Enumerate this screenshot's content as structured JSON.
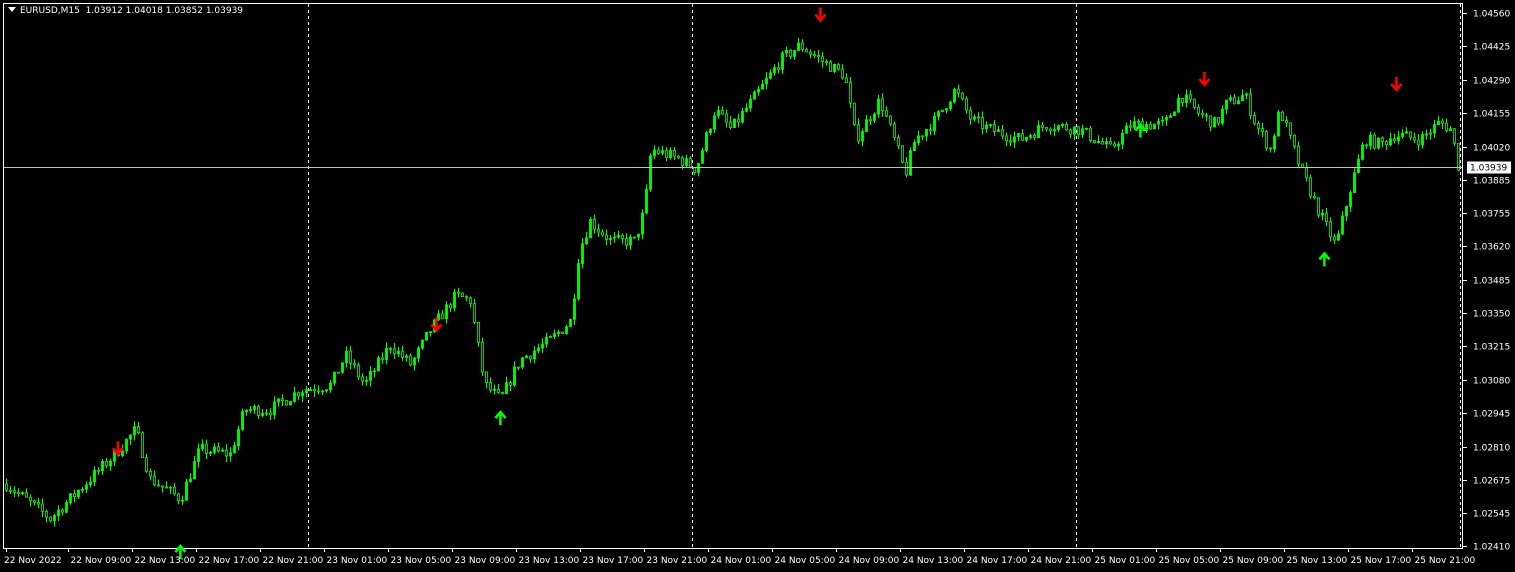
{
  "header": {
    "symbol": "EURUSD,M15",
    "ohlc": "1.03912 1.04018 1.03852 1.03939"
  },
  "colors": {
    "background": "#000000",
    "candle": "#00ff00",
    "grid": "#ffffff",
    "bid_line": "#c0c0c0",
    "arrow_up": "#00ff00",
    "arrow_down": "#ff0000"
  },
  "chart_data": {
    "type": "candlestick",
    "title": "EURUSD,M15",
    "timeframe": "M15",
    "current_price": "1.03939",
    "ylim": [
      1.0241,
      1.0456
    ],
    "y_ticks": [
      "1.04560",
      "1.04425",
      "1.04290",
      "1.04155",
      "1.04020",
      "1.03885",
      "1.03755",
      "1.03620",
      "1.03485",
      "1.03350",
      "1.03215",
      "1.03080",
      "1.02945",
      "1.02810",
      "1.02675",
      "1.02545",
      "1.02410"
    ],
    "x_ticks": [
      "22 Nov 2022",
      "22 Nov 09:00",
      "22 Nov 13:00",
      "22 Nov 17:00",
      "22 Nov 21:00",
      "23 Nov 01:00",
      "23 Nov 05:00",
      "23 Nov 09:00",
      "23 Nov 13:00",
      "23 Nov 17:00",
      "23 Nov 21:00",
      "24 Nov 01:00",
      "24 Nov 05:00",
      "24 Nov 09:00",
      "24 Nov 13:00",
      "24 Nov 17:00",
      "24 Nov 21:00",
      "25 Nov 01:00",
      "25 Nov 05:00",
      "25 Nov 09:00",
      "25 Nov 13:00",
      "25 Nov 17:00",
      "25 Nov 21:00"
    ],
    "x_tick_hours": [
      0,
      3.9,
      7.9,
      11.9,
      15.9,
      19.9,
      23.9,
      27.9,
      31.9,
      35.9,
      39.9,
      43.9,
      47.9,
      51.9,
      55.9,
      59.9,
      63.9,
      67.9,
      71.9,
      75.9,
      79.9,
      83.9,
      87.9
    ],
    "day_separator_hours": [
      18.9,
      42.9,
      66.9,
      90.9
    ],
    "price_path_hours_price": [
      [
        0,
        1.0266
      ],
      [
        2.75,
        1.0252
      ],
      [
        4.6,
        1.0264
      ],
      [
        6.8,
        1.0278
      ],
      [
        8.1,
        1.0288
      ],
      [
        9,
        1.0268
      ],
      [
        10.9,
        1.026
      ],
      [
        12.1,
        1.028
      ],
      [
        14,
        1.0278
      ],
      [
        14.9,
        1.0296
      ],
      [
        16.5,
        1.0296
      ],
      [
        18.4,
        1.0304
      ],
      [
        20.3,
        1.0306
      ],
      [
        21.2,
        1.0318
      ],
      [
        22.4,
        1.0306
      ],
      [
        24,
        1.0322
      ],
      [
        25.3,
        1.0314
      ],
      [
        26.5,
        1.0328
      ],
      [
        28.1,
        1.0342
      ],
      [
        29,
        1.034
      ],
      [
        29.9,
        1.0306
      ],
      [
        30.9,
        1.03
      ],
      [
        32.1,
        1.0316
      ],
      [
        34,
        1.0324
      ],
      [
        35.3,
        1.0332
      ],
      [
        35.8,
        1.036
      ],
      [
        36.5,
        1.0372
      ],
      [
        37.8,
        1.0364
      ],
      [
        39.3,
        1.0364
      ],
      [
        39.9,
        1.0377
      ],
      [
        40.3,
        1.0401
      ],
      [
        42.1,
        1.0397
      ],
      [
        43.1,
        1.0393
      ],
      [
        44.3,
        1.0417
      ],
      [
        45.3,
        1.0409
      ],
      [
        47.1,
        1.0425
      ],
      [
        48.4,
        1.0437
      ],
      [
        49.6,
        1.0443
      ],
      [
        50.9,
        1.0437
      ],
      [
        52.4,
        1.0431
      ],
      [
        53.1,
        1.0405
      ],
      [
        54.6,
        1.0421
      ],
      [
        55.6,
        1.0403
      ],
      [
        56.2,
        1.0391
      ],
      [
        56.8,
        1.0405
      ],
      [
        58.1,
        1.0413
      ],
      [
        59.3,
        1.0425
      ],
      [
        60.3,
        1.0413
      ],
      [
        61.5,
        1.0409
      ],
      [
        63.4,
        1.0405
      ],
      [
        65,
        1.0411
      ],
      [
        67.1,
        1.0409
      ],
      [
        69,
        1.0401
      ],
      [
        70.3,
        1.0411
      ],
      [
        72.4,
        1.0411
      ],
      [
        73.4,
        1.0423
      ],
      [
        74.6,
        1.0415
      ],
      [
        75.6,
        1.0411
      ],
      [
        76.2,
        1.0419
      ],
      [
        77.4,
        1.0423
      ],
      [
        78.1,
        1.0411
      ],
      [
        79,
        1.0401
      ],
      [
        79.6,
        1.0417
      ],
      [
        80.9,
        1.0393
      ],
      [
        82.1,
        1.0375
      ],
      [
        83.1,
        1.0362
      ],
      [
        84,
        1.0385
      ],
      [
        84.9,
        1.0405
      ],
      [
        85.9,
        1.0403
      ],
      [
        86.8,
        1.0407
      ],
      [
        88.4,
        1.0405
      ],
      [
        89.6,
        1.0412
      ],
      [
        90.3,
        1.0409
      ],
      [
        90.8,
        1.0393
      ]
    ],
    "signals": [
      {
        "type": "sell",
        "hour": 7,
        "price": 1.028
      },
      {
        "type": "sell",
        "hour": 26.9,
        "price": 1.033
      },
      {
        "type": "sell",
        "hour": 50.9,
        "price": 1.0455
      },
      {
        "type": "sell",
        "hour": 74.9,
        "price": 1.0429
      },
      {
        "type": "sell",
        "hour": 86.9,
        "price": 1.0427
      },
      {
        "type": "buy",
        "hour": 10.9,
        "price": 1.0239
      },
      {
        "type": "buy",
        "hour": 30.9,
        "price": 1.0293
      },
      {
        "type": "buy",
        "hour": 70.9,
        "price": 1.0409
      },
      {
        "type": "buy",
        "hour": 82.4,
        "price": 1.0357
      }
    ]
  }
}
